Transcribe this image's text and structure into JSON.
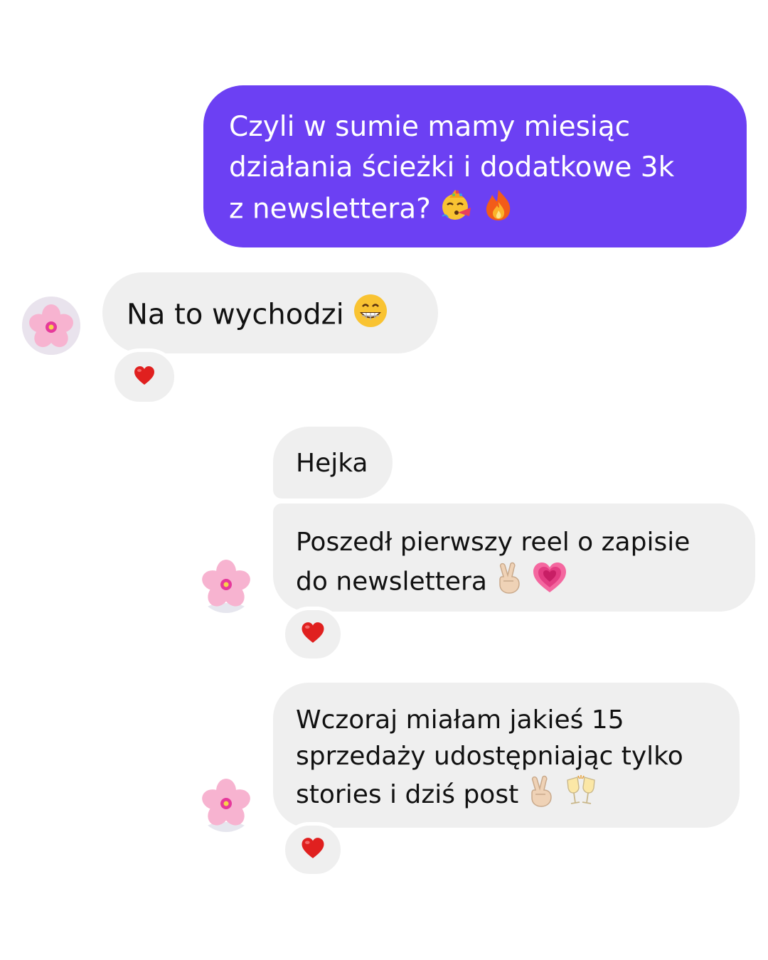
{
  "conversation": {
    "messages": [
      {
        "sender": "me",
        "lines": [
          "Czyli w sumie mamy miesiąc",
          "działania ścieżki i dodatkowe 3k",
          "z newslettera?"
        ],
        "emojis": [
          "partying-face-icon",
          "fire-icon"
        ],
        "reaction": null
      },
      {
        "sender": "contact",
        "lines": [
          "Na to wychodzi"
        ],
        "emojis": [
          "grinning-face-icon"
        ],
        "reaction": "heart-icon"
      },
      {
        "sender": "contact",
        "lines": [
          "Hejka"
        ],
        "emojis": [],
        "reaction": null
      },
      {
        "sender": "contact",
        "lines": [
          "Poszedł pierwszy reel o zapisie",
          "do newslettera"
        ],
        "emojis": [
          "victory-hand-icon",
          "growing-heart-icon"
        ],
        "reaction": "heart-icon"
      },
      {
        "sender": "contact",
        "lines": [
          "Wczoraj miałam jakieś 15",
          "sprzedaży udostępniając tylko",
          "stories i dziś post"
        ],
        "emojis": [
          "victory-hand-icon",
          "clinking-glasses-icon"
        ],
        "reaction": "heart-icon"
      }
    ]
  },
  "colors": {
    "outgoing_bubble": "#6c40f3",
    "incoming_bubble": "#efefef",
    "reaction_heart": "#e0201f",
    "avatar_flower": "#f7b3d0"
  },
  "avatar": {
    "icon": "cherry-blossom-icon"
  }
}
